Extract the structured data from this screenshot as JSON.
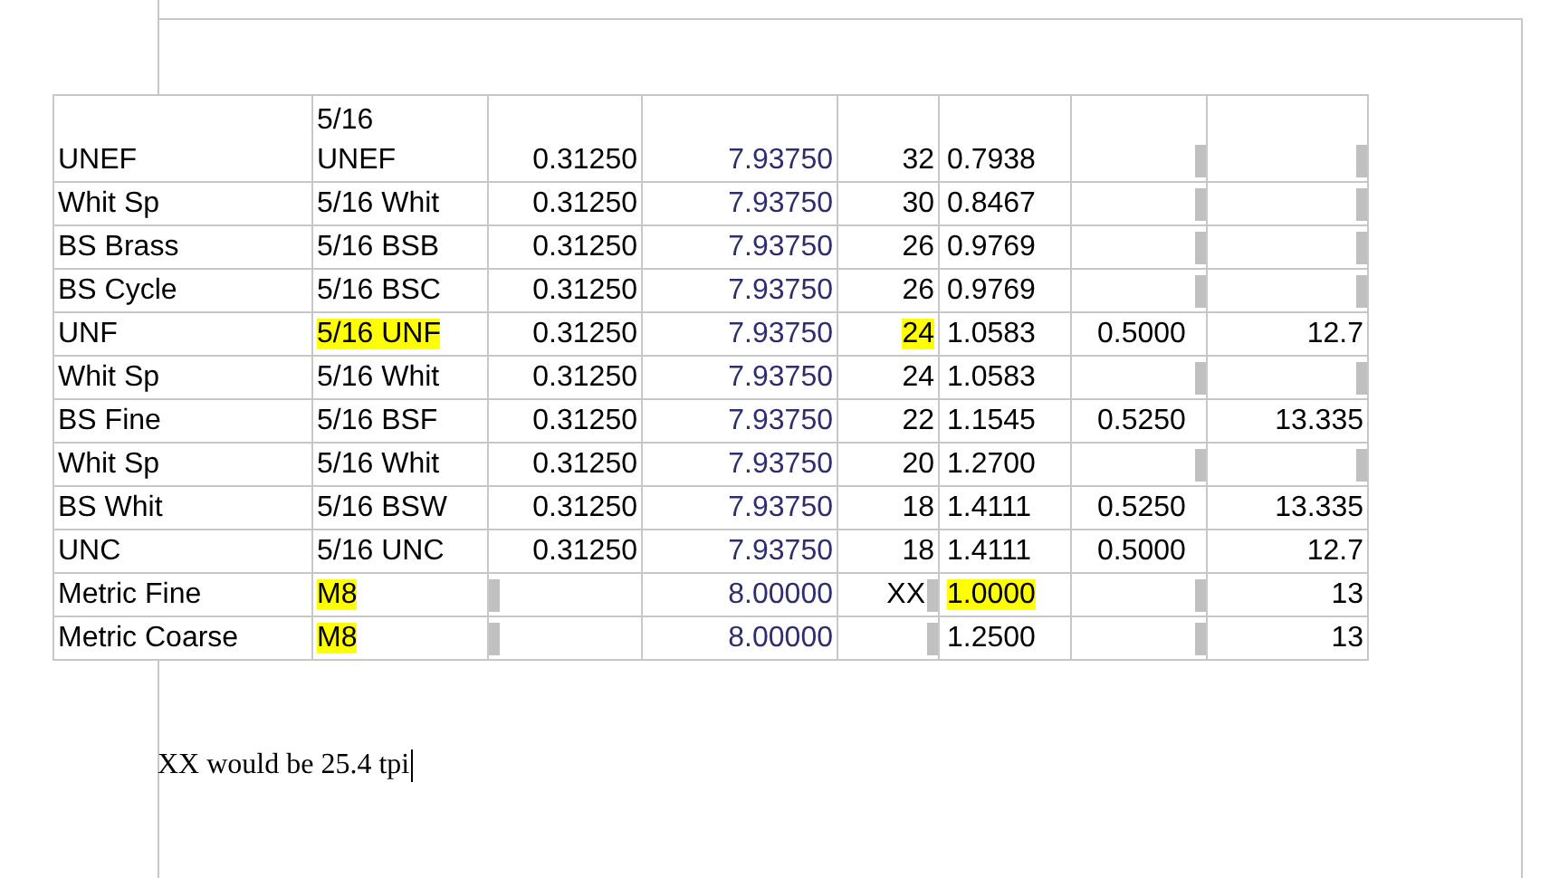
{
  "table": {
    "rows": [
      [
        {
          "text": "UNEF",
          "highlighted": false
        },
        {
          "text": "5/16\nUNEF",
          "highlighted": false
        },
        {
          "text": "0.31250",
          "highlighted": false
        },
        {
          "text": "7.93750",
          "highlighted": false
        },
        {
          "text": "32",
          "highlighted": false
        },
        {
          "text": "0.7938",
          "highlighted": false
        },
        {
          "edge_marker": true
        },
        {
          "edge_marker": true
        }
      ],
      [
        {
          "text": "Whit Sp",
          "highlighted": false
        },
        {
          "text": "5/16 Whit",
          "highlighted": false
        },
        {
          "text": "0.31250",
          "highlighted": false
        },
        {
          "text": "7.93750",
          "highlighted": false
        },
        {
          "text": "30",
          "highlighted": false
        },
        {
          "text": "0.8467",
          "highlighted": false
        },
        {
          "edge_marker": true
        },
        {
          "edge_marker": true
        }
      ],
      [
        {
          "text": "BS Brass",
          "highlighted": false
        },
        {
          "text": "5/16 BSB",
          "highlighted": false
        },
        {
          "text": "0.31250",
          "highlighted": false
        },
        {
          "text": "7.93750",
          "highlighted": false
        },
        {
          "text": "26",
          "highlighted": false
        },
        {
          "text": "0.9769",
          "highlighted": false
        },
        {
          "edge_marker": true
        },
        {
          "edge_marker": true
        }
      ],
      [
        {
          "text": "BS Cycle",
          "highlighted": false
        },
        {
          "text": "5/16 BSC",
          "highlighted": false
        },
        {
          "text": "0.31250",
          "highlighted": false
        },
        {
          "text": "7.93750",
          "highlighted": false
        },
        {
          "text": "26",
          "highlighted": false
        },
        {
          "text": "0.9769",
          "highlighted": false
        },
        {
          "edge_marker": true
        },
        {
          "edge_marker": true
        }
      ],
      [
        {
          "text": "UNF",
          "highlighted": false
        },
        {
          "text": "5/16 UNF",
          "highlighted": true
        },
        {
          "text": "0.31250",
          "highlighted": false
        },
        {
          "text": "7.93750",
          "highlighted": false
        },
        {
          "text": "24",
          "highlighted": true
        },
        {
          "text": "1.0583",
          "highlighted": false
        },
        {
          "text": "0.5000",
          "highlighted": false
        },
        {
          "text": "12.7",
          "highlighted": false
        }
      ],
      [
        {
          "text": "Whit Sp",
          "highlighted": false
        },
        {
          "text": "5/16 Whit",
          "highlighted": false
        },
        {
          "text": "0.31250",
          "highlighted": false
        },
        {
          "text": "7.93750",
          "highlighted": false
        },
        {
          "text": "24",
          "highlighted": false
        },
        {
          "text": "1.0583",
          "highlighted": false
        },
        {
          "edge_marker": true
        },
        {
          "edge_marker": true
        }
      ],
      [
        {
          "text": "BS Fine",
          "highlighted": false
        },
        {
          "text": "5/16 BSF",
          "highlighted": false
        },
        {
          "text": "0.31250",
          "highlighted": false
        },
        {
          "text": "7.93750",
          "highlighted": false
        },
        {
          "text": "22",
          "highlighted": false
        },
        {
          "text": "1.1545",
          "highlighted": false
        },
        {
          "text": "0.5250",
          "highlighted": false
        },
        {
          "text": "13.335",
          "highlighted": false
        }
      ],
      [
        {
          "text": "Whit Sp",
          "highlighted": false
        },
        {
          "text": "5/16 Whit",
          "highlighted": false
        },
        {
          "text": "0.31250",
          "highlighted": false
        },
        {
          "text": "7.93750",
          "highlighted": false
        },
        {
          "text": "20",
          "highlighted": false
        },
        {
          "text": "1.2700",
          "highlighted": false
        },
        {
          "edge_marker": true
        },
        {
          "edge_marker": true
        }
      ],
      [
        {
          "text": "BS Whit",
          "highlighted": false
        },
        {
          "text": "5/16 BSW",
          "highlighted": false
        },
        {
          "text": "0.31250",
          "highlighted": false
        },
        {
          "text": "7.93750",
          "highlighted": false
        },
        {
          "text": "18",
          "highlighted": false
        },
        {
          "text": "1.4111",
          "highlighted": false
        },
        {
          "text": "0.5250",
          "highlighted": false
        },
        {
          "text": "13.335",
          "highlighted": false
        }
      ],
      [
        {
          "text": "UNC",
          "highlighted": false
        },
        {
          "text": "5/16 UNC",
          "highlighted": false
        },
        {
          "text": "0.31250",
          "highlighted": false
        },
        {
          "text": "7.93750",
          "highlighted": false
        },
        {
          "text": "18",
          "highlighted": false
        },
        {
          "text": "1.4111",
          "highlighted": false
        },
        {
          "text": "0.5000",
          "highlighted": false
        },
        {
          "text": "12.7",
          "highlighted": false
        }
      ],
      [
        {
          "text": "Metric Fine",
          "highlighted": false
        },
        {
          "text": "M8",
          "highlighted": true
        },
        {
          "edge_marker": true
        },
        {
          "text": "8.00000",
          "highlighted": false
        },
        {
          "text": "XX",
          "highlighted": false,
          "edge_marker": true
        },
        {
          "text": "1.0000",
          "highlighted": true
        },
        {
          "edge_marker": true
        },
        {
          "text": "13",
          "highlighted": false
        }
      ],
      [
        {
          "text": "Metric Coarse",
          "highlighted": false
        },
        {
          "text": "M8",
          "highlighted": true
        },
        {
          "edge_marker": true
        },
        {
          "text": "8.00000",
          "highlighted": false
        },
        {
          "edge_marker": true
        },
        {
          "text": "1.2500",
          "highlighted": false
        },
        {
          "edge_marker": true
        },
        {
          "text": "13",
          "highlighted": false
        }
      ]
    ]
  },
  "note": {
    "text": "XX would be 25.4 tpi"
  }
}
